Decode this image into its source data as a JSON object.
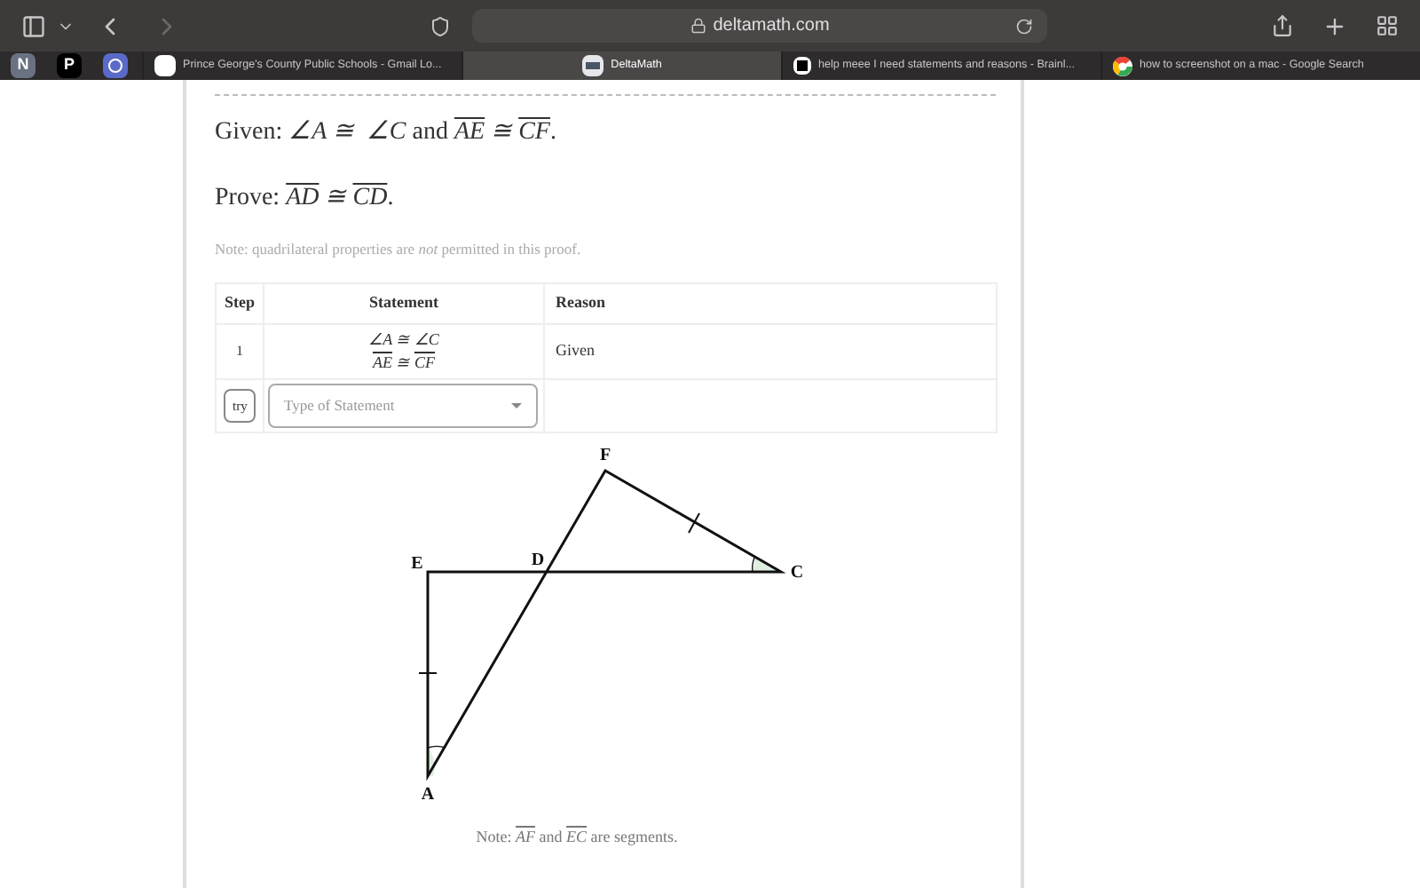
{
  "browser": {
    "address": "deltamath.com"
  },
  "pinned_tabs": [
    {
      "kind": "letter",
      "text": "N"
    },
    {
      "kind": "letter",
      "text": "P"
    },
    {
      "kind": "logo"
    }
  ],
  "tabs": [
    {
      "title": "Prince George's County Public Schools - Gmail Lo...",
      "selected": false
    },
    {
      "title": "DeltaMath",
      "selected": true
    },
    {
      "title": "help meee I need statements and reasons - Brainl...",
      "selected": false
    },
    {
      "title": "how to screenshot on a mac - Google Search",
      "selected": false
    }
  ],
  "problem": {
    "given": [
      {
        "kind": "text",
        "text": "Given: "
      },
      {
        "kind": "math",
        "text": "∠A ≅  ∠C"
      },
      {
        "kind": "text",
        "text": " and "
      },
      {
        "kind": "segment",
        "text": "AE"
      },
      {
        "kind": "math",
        "text": " ≅ "
      },
      {
        "kind": "segment",
        "text": "CF"
      },
      {
        "kind": "text",
        "text": "."
      }
    ],
    "prove": [
      {
        "kind": "text",
        "text": "Prove: "
      },
      {
        "kind": "segment",
        "text": "AD"
      },
      {
        "kind": "math",
        "text": " ≅ "
      },
      {
        "kind": "segment",
        "text": "CD"
      },
      {
        "kind": "text",
        "text": "."
      }
    ],
    "note": "Note: quadrilateral properties are *not* permitted in this proof."
  },
  "table": {
    "columns": [
      "Step",
      "Statement",
      "Reason"
    ],
    "rows": [
      {
        "step": "1",
        "statement": [
          [
            {
              "kind": "math",
              "text": "∠A ≅ ∠C"
            }
          ],
          [
            {
              "kind": "segment",
              "text": "AE"
            },
            {
              "kind": "math",
              "text": " ≅ "
            },
            {
              "kind": "segment",
              "text": "CF"
            }
          ]
        ],
        "reason": "Given"
      }
    ],
    "new_row": {
      "button": "try",
      "placeholder": "Type of Statement"
    }
  },
  "diagram": {
    "points": [
      "F",
      "E",
      "D",
      "C",
      "A"
    ],
    "caption": [
      {
        "kind": "text",
        "text": "Note: "
      },
      {
        "kind": "segment",
        "text": "AF"
      },
      {
        "kind": "text",
        "text": " and "
      },
      {
        "kind": "segment",
        "text": "EC"
      },
      {
        "kind": "text",
        "text": " are segments."
      }
    ]
  }
}
